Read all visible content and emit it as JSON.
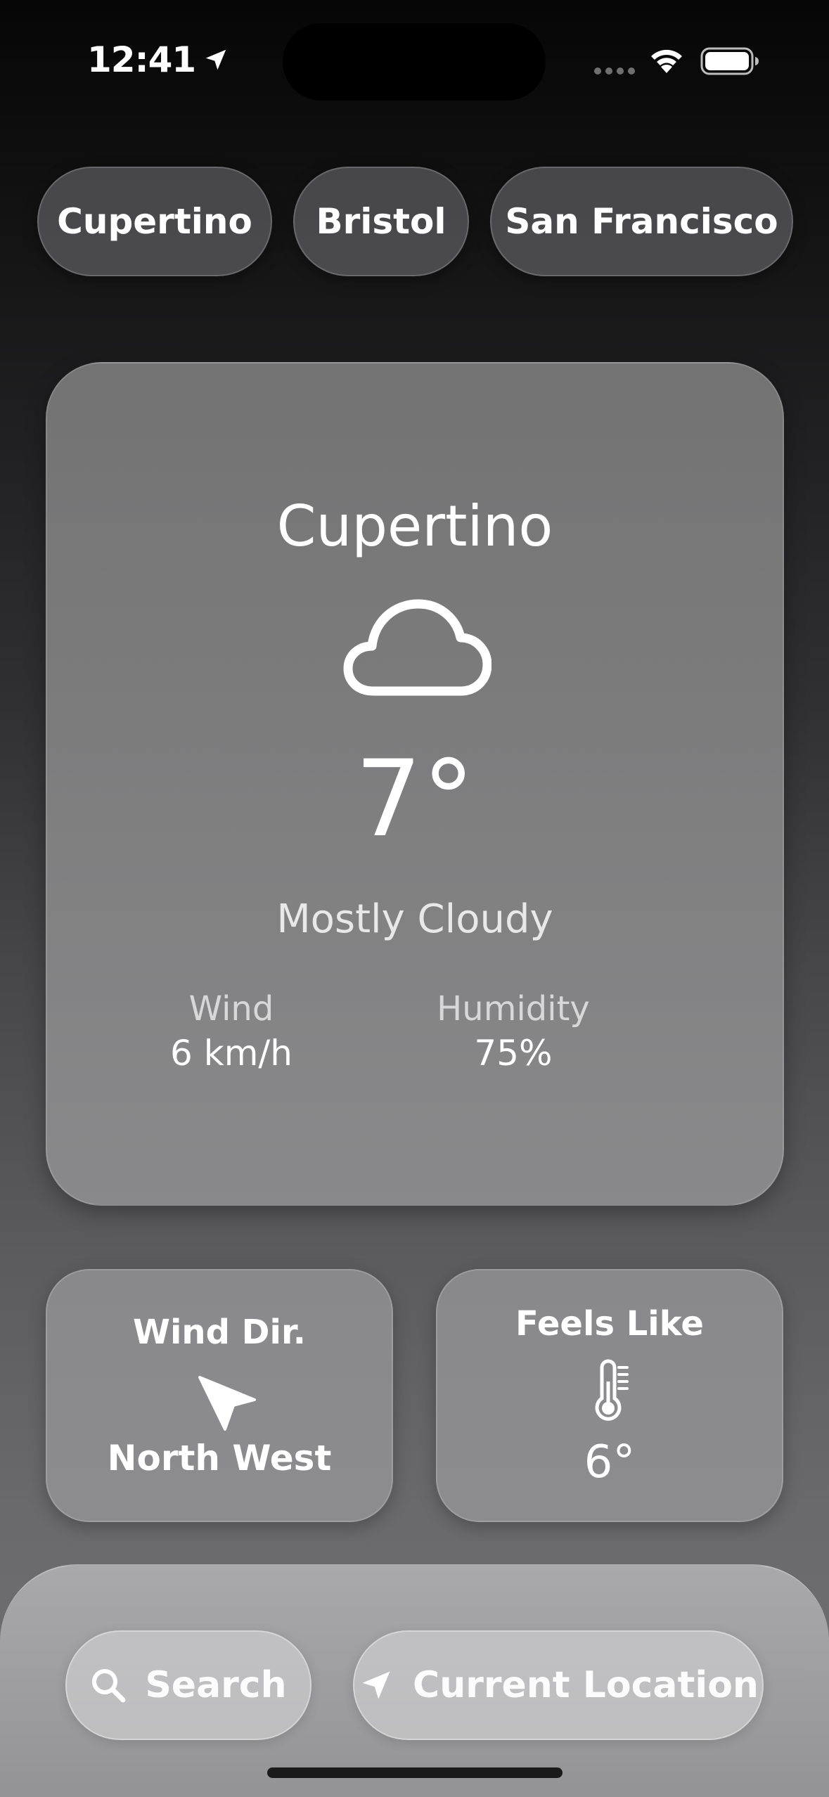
{
  "status_bar": {
    "time": "12:41",
    "location_icon": "location-arrow-icon",
    "wifi_icon": "wifi-icon",
    "battery_icon": "battery-icon"
  },
  "city_tabs": [
    {
      "label": "Cupertino"
    },
    {
      "label": "Bristol"
    },
    {
      "label": "San Francisco"
    }
  ],
  "weather": {
    "city": "Cupertino",
    "condition_icon": "cloud-icon",
    "temperature": "7°",
    "condition": "Mostly Cloudy",
    "wind_label": "Wind",
    "wind_value": "6 km/h",
    "humidity_label": "Humidity",
    "humidity_value": "75%"
  },
  "wind_direction": {
    "title": "Wind Dir.",
    "icon": "arrow-pointer-icon",
    "value": "North West"
  },
  "feels_like": {
    "title": "Feels Like",
    "icon": "thermometer-icon",
    "value": "6°"
  },
  "bottom_bar": {
    "search_label": "Search",
    "search_icon": "magnifying-glass-icon",
    "location_label": "Current Location",
    "location_icon": "location-arrow-icon"
  },
  "colors": {
    "text": "#ffffff",
    "card": "#7a7a7a",
    "background_top": "#060606",
    "background_bottom": "#707072"
  }
}
